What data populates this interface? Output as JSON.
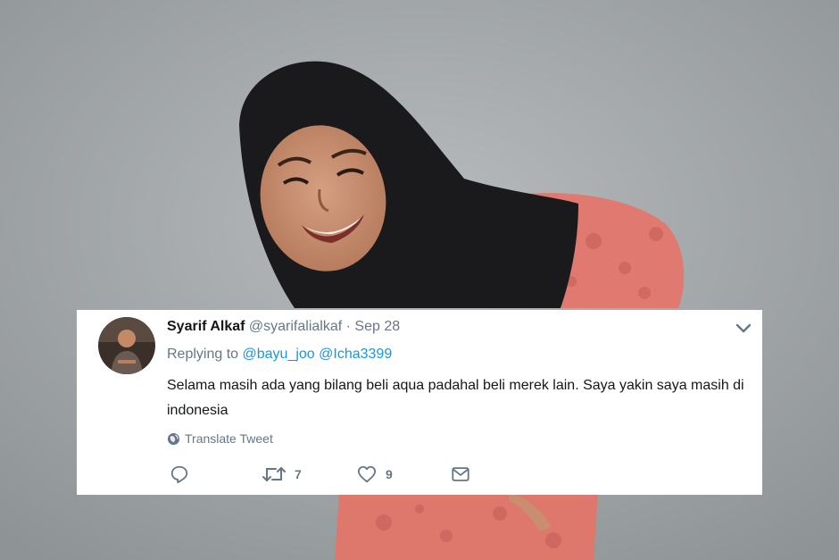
{
  "tweet": {
    "author_name": "Syarif Alkaf",
    "handle": "@syarifalialkaf",
    "separator": "·",
    "date": "Sep 28",
    "replying_prefix": "Replying to",
    "mentions": [
      "@bayu_joo",
      "@Icha3399"
    ],
    "text": "Selama masih ada yang bilang beli aqua padahal beli merek lain. Saya yakin saya masih di indonesia",
    "translate_label": "Translate Tweet",
    "reply_count": "",
    "retweet_count": "7",
    "like_count": "9"
  },
  "icons": {
    "menu": "chevron-down-icon",
    "translate": "globe-icon",
    "reply": "reply-icon",
    "retweet": "retweet-icon",
    "like": "heart-icon",
    "dm": "envelope-icon"
  },
  "colors": {
    "name": "#14171a",
    "secondary": "#657786",
    "link": "#1b95e0",
    "card_bg": "#ffffff",
    "background": "#a9adaf",
    "dress": "#e27a6f",
    "hijab": "#1a1a1d"
  }
}
